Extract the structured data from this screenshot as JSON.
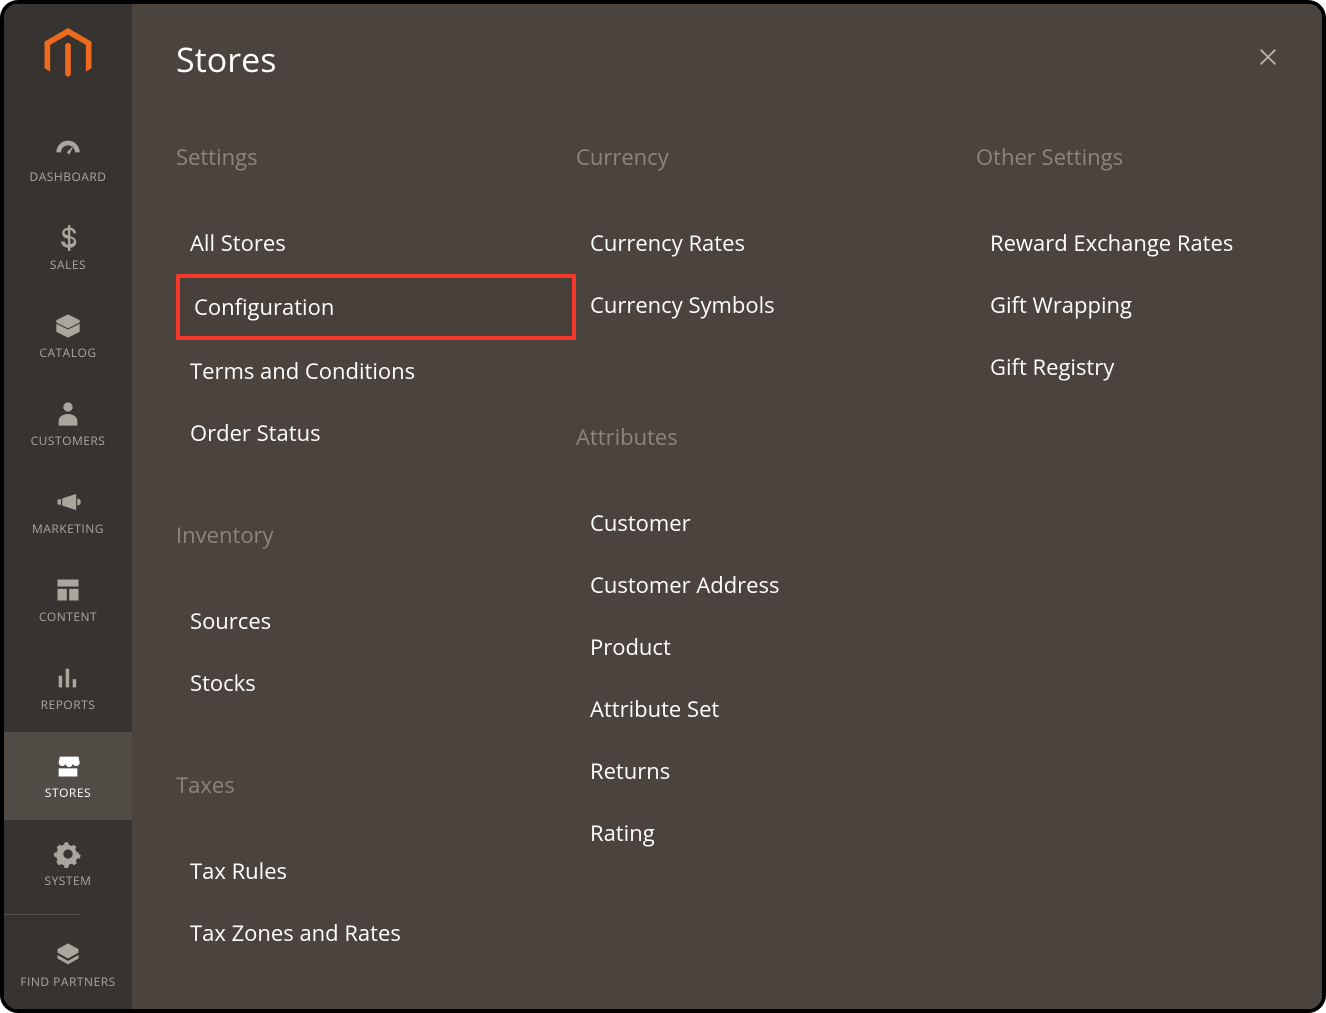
{
  "sidebar": {
    "items": [
      {
        "id": "dashboard",
        "label": "DASHBOARD"
      },
      {
        "id": "sales",
        "label": "SALES"
      },
      {
        "id": "catalog",
        "label": "CATALOG"
      },
      {
        "id": "customers",
        "label": "CUSTOMERS"
      },
      {
        "id": "marketing",
        "label": "MARKETING"
      },
      {
        "id": "content",
        "label": "CONTENT"
      },
      {
        "id": "reports",
        "label": "REPORTS"
      },
      {
        "id": "stores",
        "label": "STORES",
        "active": true
      },
      {
        "id": "system",
        "label": "SYSTEM"
      },
      {
        "id": "find-partners",
        "label": "FIND PARTNERS"
      }
    ]
  },
  "flyout": {
    "title": "Stores",
    "columns": [
      {
        "groups": [
          {
            "title": "Settings",
            "items": [
              {
                "label": "All Stores"
              },
              {
                "label": "Configuration",
                "highlight": true
              },
              {
                "label": "Terms and Conditions"
              },
              {
                "label": "Order Status"
              }
            ]
          },
          {
            "title": "Inventory",
            "items": [
              {
                "label": "Sources"
              },
              {
                "label": "Stocks"
              }
            ]
          },
          {
            "title": "Taxes",
            "items": [
              {
                "label": "Tax Rules"
              },
              {
                "label": "Tax Zones and Rates"
              }
            ]
          }
        ]
      },
      {
        "groups": [
          {
            "title": "Currency",
            "items": [
              {
                "label": "Currency Rates"
              },
              {
                "label": "Currency Symbols"
              }
            ]
          },
          {
            "title": "Attributes",
            "items": [
              {
                "label": "Customer"
              },
              {
                "label": "Customer Address"
              },
              {
                "label": "Product"
              },
              {
                "label": "Attribute Set"
              },
              {
                "label": "Returns"
              },
              {
                "label": "Rating"
              }
            ]
          }
        ]
      },
      {
        "groups": [
          {
            "title": "Other Settings",
            "items": [
              {
                "label": "Reward Exchange Rates"
              },
              {
                "label": "Gift Wrapping"
              },
              {
                "label": "Gift Registry"
              }
            ]
          }
        ]
      }
    ]
  }
}
